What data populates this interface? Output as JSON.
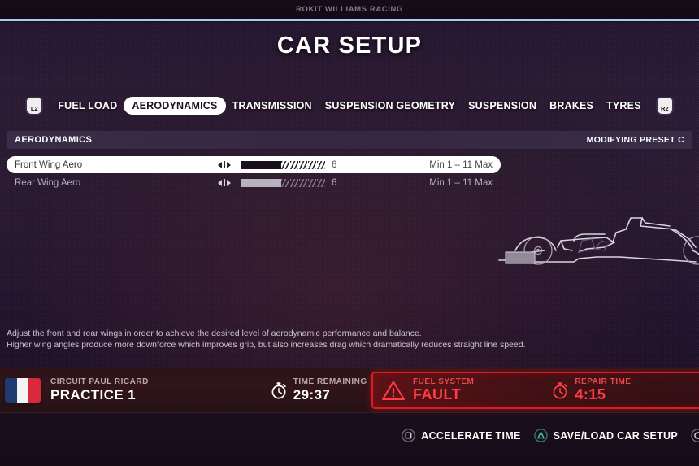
{
  "header": {
    "team": "ROKIT WILLIAMS RACING",
    "title": "CAR SETUP"
  },
  "nav": {
    "prev_trigger": "L2",
    "next_trigger": "R2",
    "tabs": [
      {
        "label": "FUEL LOAD",
        "active": false
      },
      {
        "label": "AERODYNAMICS",
        "active": true
      },
      {
        "label": "TRANSMISSION",
        "active": false
      },
      {
        "label": "SUSPENSION GEOMETRY",
        "active": false
      },
      {
        "label": "SUSPENSION",
        "active": false
      },
      {
        "label": "BRAKES",
        "active": false
      },
      {
        "label": "TYRES",
        "active": false
      }
    ]
  },
  "section": {
    "title": "AERODYNAMICS",
    "preset_label": "MODIFYING PRESET  C"
  },
  "settings": [
    {
      "label": "Front Wing Aero",
      "value": "6",
      "filled": 5,
      "empty": 5,
      "range": "Min 1 – 11 Max",
      "selected": true
    },
    {
      "label": "Rear Wing Aero",
      "value": "6",
      "filled": 5,
      "empty": 5,
      "range": "Min 1 – 11 Max",
      "selected": false
    }
  ],
  "description": {
    "line1": "Adjust the front and rear wings in order to achieve the desired level of aerodynamic performance and balance.",
    "line2": "Higher wing angles produce more downforce which improves grip, but also increases drag which dramatically reduces straight line speed."
  },
  "status": {
    "circuit": "CIRCUIT PAUL RICARD",
    "session": "PRACTICE 1",
    "time_label": "TIME REMAINING",
    "time_value": "29:37"
  },
  "fault": {
    "system": "FUEL SYSTEM",
    "state": "FAULT",
    "repair_label": "REPAIR TIME",
    "repair_value": "4:15"
  },
  "footer": {
    "accelerate_label": "ACCELERATE TIME",
    "save_label": "SAVE/LOAD CAR SETUP"
  },
  "colors": {
    "accent_line": "#a9cde8",
    "fault_red": "#e01a22",
    "triangle_green": "#3fbfa0",
    "square_gray": "#9d96a6"
  }
}
